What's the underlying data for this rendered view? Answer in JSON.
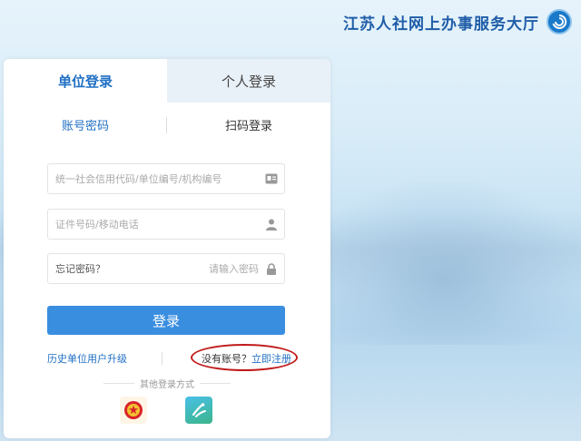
{
  "header": {
    "site_title": "江苏人社网上办事服务大厅"
  },
  "login": {
    "tabs": [
      {
        "label": "单位登录",
        "active": true
      },
      {
        "label": "个人登录",
        "active": false
      }
    ],
    "subtabs": [
      {
        "label": "账号密码",
        "active": true
      },
      {
        "label": "扫码登录",
        "active": false
      }
    ],
    "fields": {
      "org_code": {
        "placeholder": "统一社会信用代码/单位编号/机构编号",
        "value": ""
      },
      "id_phone": {
        "placeholder": "证件号码/移动电话",
        "value": ""
      },
      "password": {
        "placeholder": "请输入密码",
        "value": ""
      }
    },
    "forgot_label": "忘记密码？",
    "submit_label": "登录",
    "upgrade_link": "历史单位用户升级",
    "no_account": "没有账号？",
    "register_link": "立即注册",
    "other_methods_title": "其他登录方式"
  },
  "icons": {
    "logo": "swirl-logo-icon",
    "org": "id-card-icon",
    "user": "user-icon",
    "lock": "lock-icon",
    "emblem": "national-emblem-icon",
    "app": "mobile-app-icon"
  },
  "colors": {
    "primary": "#3a8ee0",
    "link": "#1f6fc4",
    "title": "#1f5da8",
    "annotation": "#c01a1a"
  }
}
